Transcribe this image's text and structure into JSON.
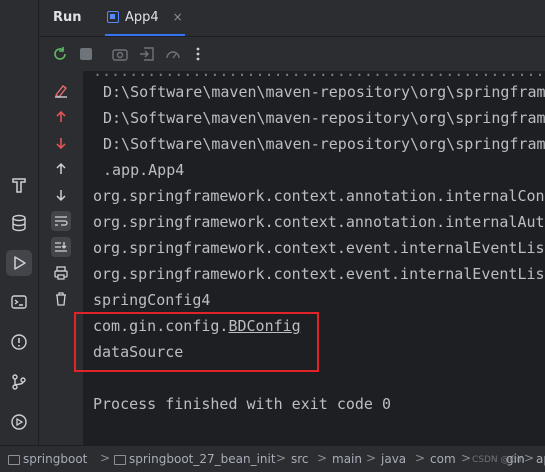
{
  "header": {
    "title": "Run",
    "tab_label": "App4",
    "close_glyph": "×"
  },
  "toolbar": {
    "icons": [
      "rerun-icon",
      "stop-icon",
      "screenshot-icon",
      "restore-layout-icon",
      "profiler-icon",
      "more-icon"
    ]
  },
  "gutter": {
    "icons": [
      "clear-icon",
      "up-arrow-red-icon",
      "down-arrow-red-icon",
      "up-arrow-icon",
      "down-arrow-icon",
      "soft-wrap-icon",
      "scroll-to-end-icon",
      "print-icon",
      "trash-icon"
    ]
  },
  "left_strip": {
    "icons": [
      "build-icon",
      "database-icon",
      "run-icon",
      "terminal-icon",
      "problems-icon",
      "git-icon",
      "services-icon"
    ]
  },
  "console": {
    "lines": [
      {
        "text": "D:\\Software\\maven\\maven-repository\\org\\springfram",
        "indent": true
      },
      {
        "text": "D:\\Software\\maven\\maven-repository\\org\\springfram",
        "indent": true
      },
      {
        "text": "D:\\Software\\maven\\maven-repository\\org\\springfram",
        "indent": true
      },
      {
        "text": ".app.App4",
        "indent": true
      },
      {
        "text": "org.springframework.context.annotation.internalConf",
        "indent": false
      },
      {
        "text": "org.springframework.context.annotation.internalAuto",
        "indent": false
      },
      {
        "text": "org.springframework.context.event.internalEventList",
        "indent": false
      },
      {
        "text": "org.springframework.context.event.internalEventList",
        "indent": false
      },
      {
        "text": "springConfig4",
        "indent": false
      },
      {
        "text_prefix": "com.gin.config.",
        "text_underlined": "BDConfig",
        "indent": false
      },
      {
        "text": "dataSource",
        "indent": false
      },
      {
        "text": "",
        "indent": false
      },
      {
        "text": "Process finished with exit code 0",
        "indent": false
      }
    ]
  },
  "statusbar": {
    "crumbs": [
      "springboot",
      "springboot_27_bean_init",
      "src",
      "main",
      "java",
      "com",
      "gin",
      "app"
    ],
    "separator": ">",
    "watermark": "CSDN @Gin"
  },
  "colors": {
    "highlight_box": "#e0242a",
    "accent": "#3574f0",
    "console_bg": "#1e1f22",
    "panel_bg": "#2b2d30"
  }
}
